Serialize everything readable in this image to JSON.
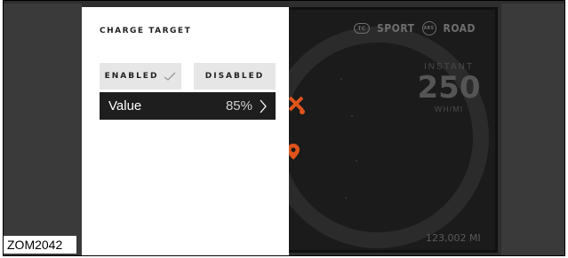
{
  "panel": {
    "title": "CHARGE TARGET",
    "enabled_label": "ENABLED",
    "disabled_label": "DISABLED",
    "value_label": "Value",
    "value": "85%"
  },
  "status": {
    "tc_label": "TC",
    "sport_label": "SPORT",
    "abs_label": "ABS",
    "road_label": "ROAD"
  },
  "instant": {
    "label": "INSTANT",
    "value": "250",
    "unit": "WH/MI"
  },
  "odometer": "123,002 MI",
  "caption": "ZOM2042",
  "colors": {
    "accent": "#e0541c",
    "panel_bg": "#ffffff",
    "display_bg": "#1b1b1b",
    "row_bg": "#1e1e1e"
  }
}
